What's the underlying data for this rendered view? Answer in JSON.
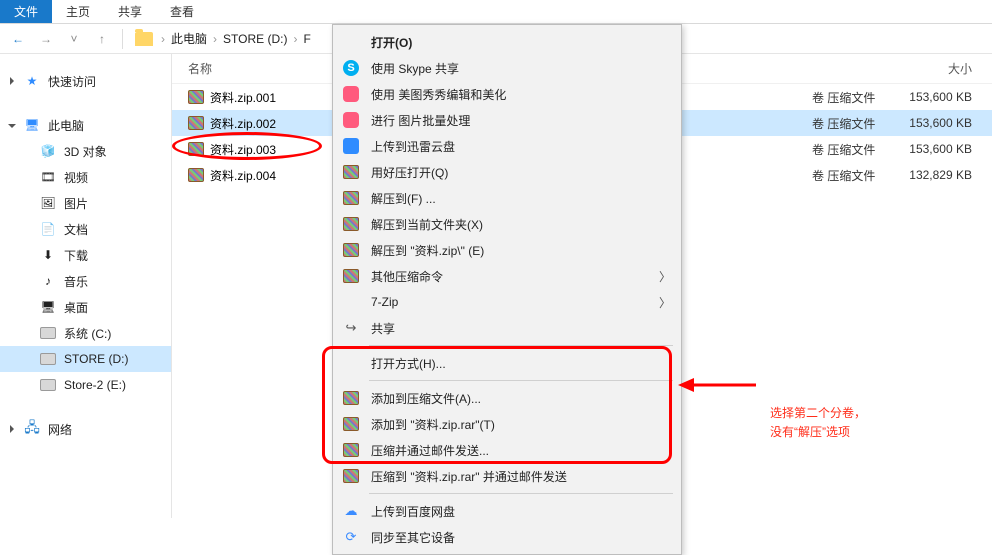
{
  "ribbon": {
    "tabs": [
      "文件",
      "主页",
      "共享",
      "查看"
    ]
  },
  "breadcrumb": {
    "root": "此电脑",
    "drive": "STORE (D:)"
  },
  "sidebar": {
    "quick": "快速访问",
    "pc": "此电脑",
    "items": [
      {
        "label": "3D 对象",
        "icon": "🧊"
      },
      {
        "label": "视频",
        "icon": "🎞"
      },
      {
        "label": "图片",
        "icon": "🖼"
      },
      {
        "label": "文档",
        "icon": "📄"
      },
      {
        "label": "下载",
        "icon": "⬇"
      },
      {
        "label": "音乐",
        "icon": "♪"
      },
      {
        "label": "桌面",
        "icon": "🖥"
      },
      {
        "label": "系统 (C:)",
        "icon": "hdd"
      },
      {
        "label": "STORE (D:)",
        "icon": "hdd",
        "selected": true
      },
      {
        "label": "Store-2 (E:)",
        "icon": "hdd"
      }
    ],
    "network": "网络"
  },
  "columns": {
    "name": "名称",
    "size": "大小"
  },
  "files": [
    {
      "name": "资料.zip.001",
      "type": "卷 压缩文件",
      "size": "153,600 KB"
    },
    {
      "name": "资料.zip.002",
      "type": "卷 压缩文件",
      "size": "153,600 KB",
      "selected": true,
      "circled": true
    },
    {
      "name": "资料.zip.003",
      "type": "卷 压缩文件",
      "size": "153,600 KB"
    },
    {
      "name": "资料.zip.004",
      "type": "卷 压缩文件",
      "size": "132,829 KB"
    }
  ],
  "ctx": {
    "open": "打开(O)",
    "skype": "使用 Skype 共享",
    "meitu": "使用 美图秀秀编辑和美化",
    "batch": "进行 图片批量处理",
    "xunlei": "上传到迅雷云盘",
    "haoya": "用好压打开(Q)",
    "extract_f": "解压到(F) ...",
    "extract_here": "解压到当前文件夹(X)",
    "extract_named": "解压到 \"资料.zip\\\" (E)",
    "other_cmd": "其他压缩命令",
    "sevenzip": "7-Zip",
    "share": "共享",
    "openwith": "打开方式(H)...",
    "add_arch": "添加到压缩文件(A)...",
    "add_rar": "添加到 \"资料.zip.rar\"(T)",
    "mail": "压缩并通过邮件发送...",
    "mail_rar": "压缩到 \"资料.zip.rar\" 并通过邮件发送",
    "baidu": "上传到百度网盘",
    "sync": "同步至其它设备"
  },
  "annotation": {
    "line1": "选择第二个分卷，",
    "line2": "没有“解压”选项"
  }
}
